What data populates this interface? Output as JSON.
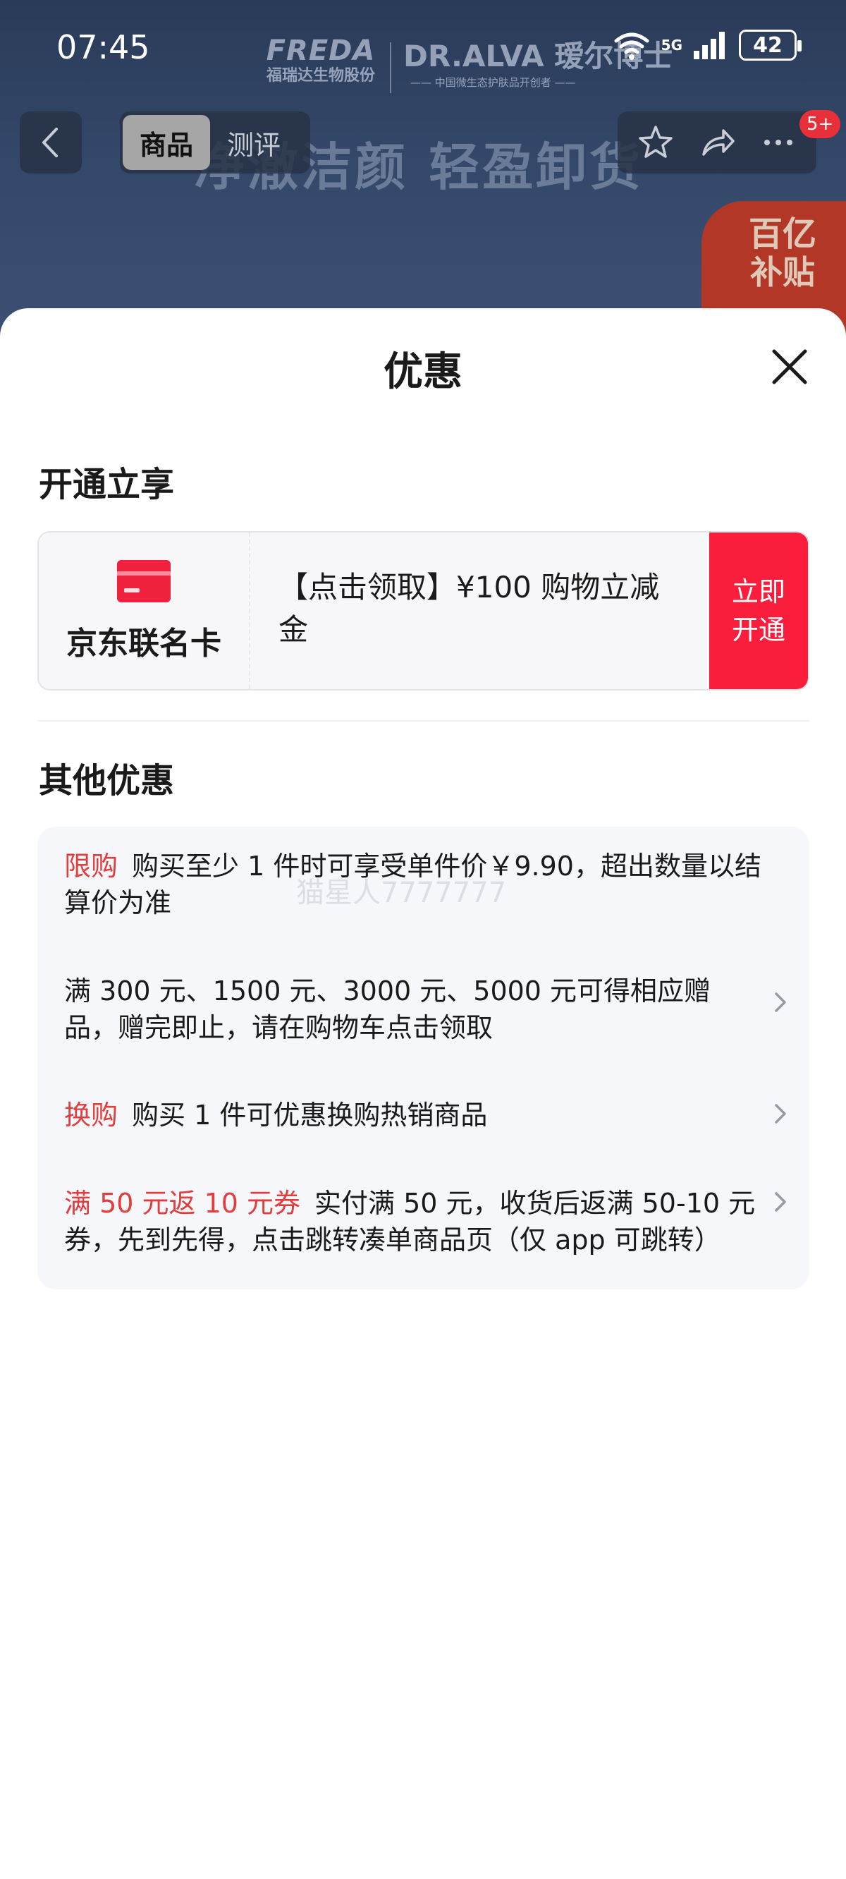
{
  "status_bar": {
    "time": "07:45",
    "network": "5G",
    "battery": "42"
  },
  "background_page": {
    "brand1_en": "FREDA",
    "brand1_zh": "福瑞达生物股份",
    "brand2_en": "DR.ALVA 瑷尔博士",
    "brand2_sub": "—— 中国微生态护肤品开创者 ——",
    "slogan": "净澈洁颜 轻盈卸货",
    "promo_badge_line1": "百亿",
    "promo_badge_line2": "补贴"
  },
  "nav": {
    "tabs": [
      {
        "label": "商品",
        "active": true
      },
      {
        "label": "测评",
        "active": false
      }
    ],
    "notification_badge": "5+"
  },
  "sheet": {
    "title": "优惠",
    "section_open": "开通立享",
    "card": {
      "name": "京东联名卡",
      "description": "【点击领取】¥100 购物立减金",
      "button": "立即开通"
    },
    "section_other": "其他优惠",
    "offers": [
      {
        "tag": "限购",
        "text": "购买至少 1 件时可享受单件价￥9.90，超出数量以结算价为准",
        "has_arrow": false
      },
      {
        "tag": "",
        "text": "满 300 元、1500 元、3000 元、5000 元可得相应赠品，赠完即止，请在购物车点击领取",
        "has_arrow": true
      },
      {
        "tag": "换购",
        "text": "购买 1 件可优惠换购热销商品",
        "has_arrow": true
      },
      {
        "tag": "满 50 元返 10 元券",
        "text": "实付满 50 元，收货后返满 50-10 元券，先到先得，点击跳转凑单商品页（仅 app 可跳转）",
        "has_arrow": true
      }
    ],
    "watermark": "猫星人7777777"
  },
  "colors": {
    "accent_red": "#fa1e3c",
    "tag_red": "#e23d3d",
    "background_blue": "#34486a"
  }
}
